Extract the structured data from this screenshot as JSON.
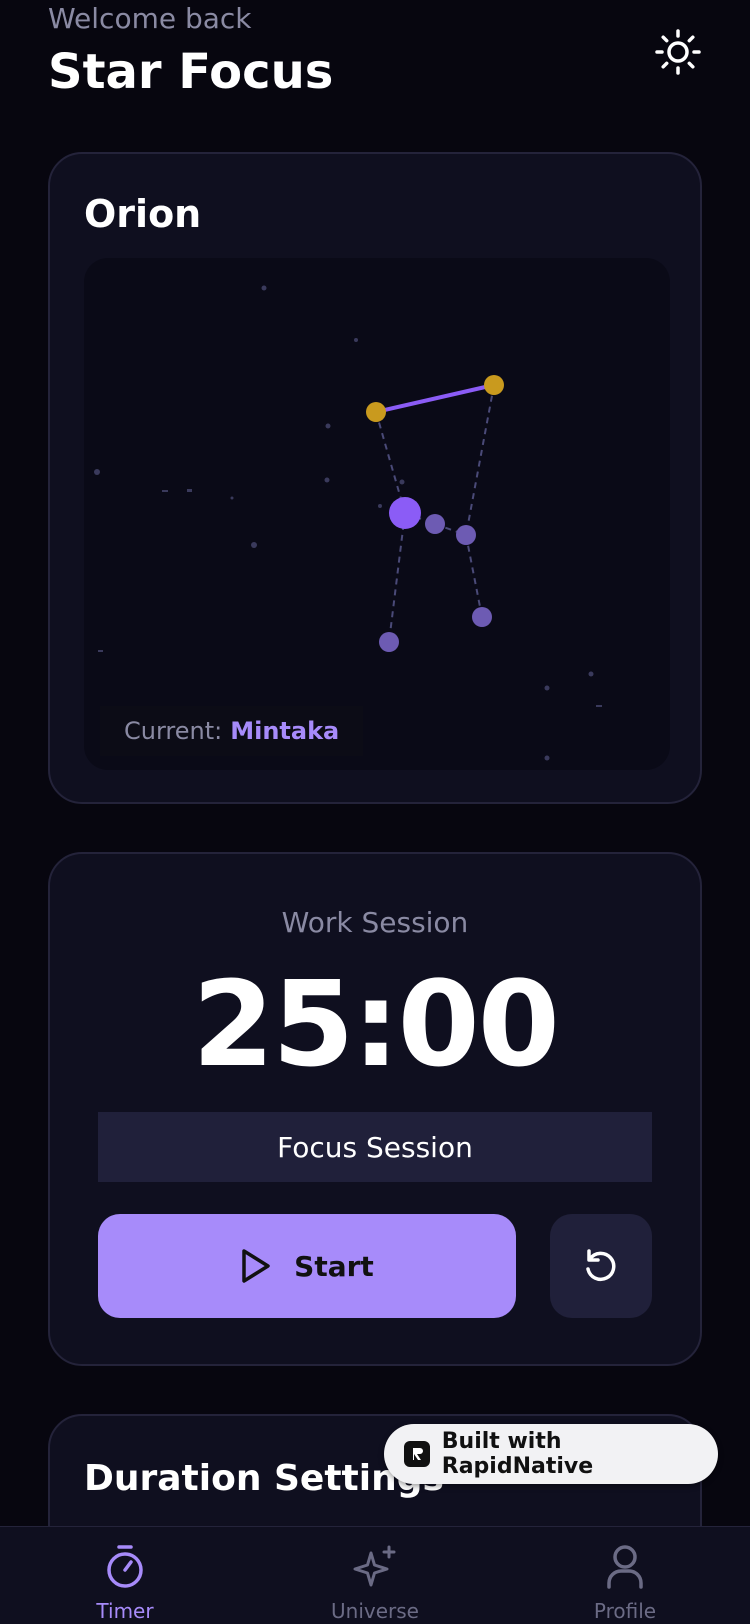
{
  "header": {
    "welcome": "Welcome back",
    "title": "Star Focus",
    "theme_icon": "sun-icon"
  },
  "constellation": {
    "name": "Orion",
    "current_label": "Current:",
    "current_star": "Mintaka"
  },
  "timer": {
    "session_type": "Work Session",
    "display": "25:00",
    "session_label": "Focus Session",
    "start_label": "Start",
    "start_icon": "play-icon",
    "reset_icon": "reset-icon"
  },
  "duration": {
    "title": "Duration Settings"
  },
  "badge": {
    "text": "Built with RapidNative"
  },
  "nav": {
    "items": [
      {
        "label": "Timer",
        "icon": "timer-icon",
        "active": true
      },
      {
        "label": "Universe",
        "icon": "sparkles-icon",
        "active": false
      },
      {
        "label": "Profile",
        "icon": "user-icon",
        "active": false
      }
    ]
  },
  "colors": {
    "background": "#07060f",
    "card": "#0f0f1f",
    "accent": "#a78bfa",
    "star_gold": "#c99a1e",
    "muted_text": "#8a8aa3"
  }
}
